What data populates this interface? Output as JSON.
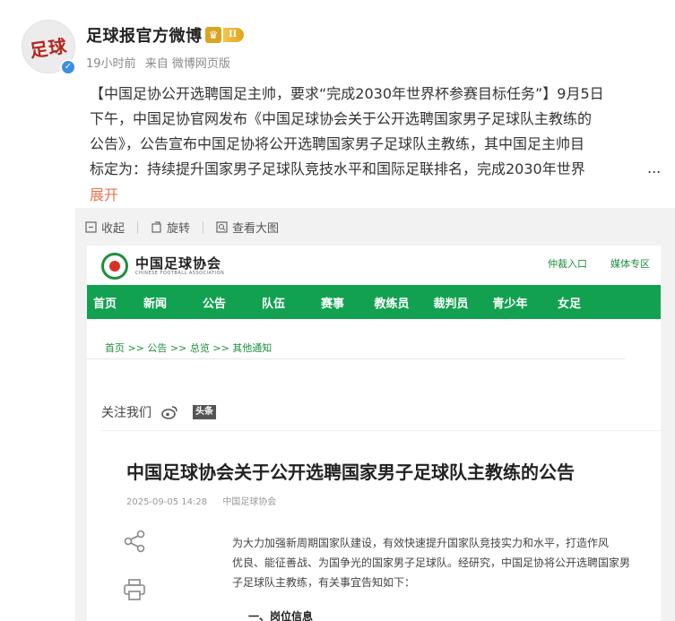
{
  "post": {
    "author": "足球报官方微博",
    "avatar_text": "足球",
    "badge_level": "II",
    "time": "19小时前",
    "source": "来自 微博网页版",
    "text_lines": [
      "【中国足协公开选聘国足主帅，要求“完成2030年世界杯参赛目标任务”】9月5日",
      "下午，中国足协官网发布《中国足球协会关于公开选聘国家男子足球队主教练的",
      "公告》，公告宣布中国足协将公开选聘国家男子足球队主教练，其中国足主帅目",
      "标定为：持续提升国家男子足球队竞技水平和国际足联排名，完成2030年世界"
    ],
    "ellipsis": "...",
    "expand_label": "展开"
  },
  "viewer": {
    "collapse_label": "收起",
    "rotate_label": "旋转",
    "view_large_label": "查看大图"
  },
  "shot": {
    "org_name": "中国足球协会",
    "org_name_en": "CHINESE FOOTBALL ASSOCIATION",
    "top_links": [
      "仲裁入口",
      "媒体专区"
    ],
    "nav": [
      "首页",
      "新闻",
      "公告",
      "队伍",
      "赛事",
      "教练员",
      "裁判员",
      "青少年",
      "女足"
    ],
    "breadcrumb": "首页  >>  公告  >>  总览  >>  其他通知",
    "follow_label": "关注我们",
    "toutiao_label": "头条",
    "article": {
      "title": "中国足球协会关于公开选聘国家男子足球队主教练的公告",
      "date": "2025-09-05 14:28",
      "publisher": "中国足球协会",
      "body_lines": [
        "为大力加强新周期国家队建设，有效快速提升国家队竞技实力和水平，打造作风",
        "优良、能征善战、为国争光的国家男子足球队。经研究，中国足协将公开选聘国家男",
        "子足球队主教练，有关事宜告知如下："
      ],
      "section_heading": "一、岗位信息"
    }
  }
}
